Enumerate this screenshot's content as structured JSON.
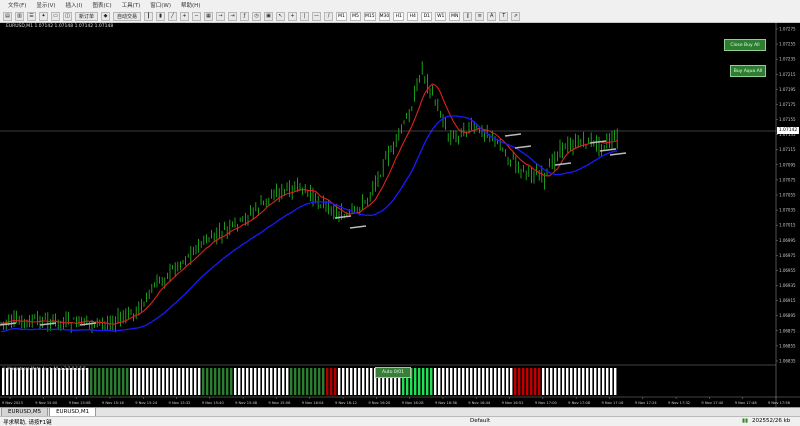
{
  "menu": [
    "文件(F)",
    "显示(V)",
    "插入(I)",
    "图表(C)",
    "工具(T)",
    "窗口(W)",
    "帮助(H)"
  ],
  "toolbar": {
    "new_order": "新订单",
    "autotrade": "自动交易",
    "timeframes": [
      "M1",
      "M5",
      "M15",
      "M30",
      "H1",
      "H4",
      "D1",
      "W1",
      "MN"
    ]
  },
  "chart": {
    "symbol_info": "EURUSD,M1  1.07142 1.07148 1.07142 1.07148",
    "current_price": "1.07142",
    "button_top": "Close Buy All",
    "button_mid": "Buy Aqua All",
    "indicator_label": "Ⓒ Marketcore Meta 4u  ↑ 40  ↓ 2  2.8  1.5.5",
    "indicator_button": "Auto 0/01",
    "y_ticks": [
      "1.07275",
      "1.07255",
      "1.07235",
      "1.07215",
      "1.07195",
      "1.07175",
      "1.07155",
      "1.07135",
      "1.07115",
      "1.07095",
      "1.07075",
      "1.07055",
      "1.07035",
      "1.07015",
      "1.06995",
      "1.06975",
      "1.06955",
      "1.06935",
      "1.06915",
      "1.06895",
      "1.06875",
      "1.06855",
      "1.06835"
    ],
    "x_ticks": [
      "9 Nov 2023",
      "9 Nov 15:00",
      "9 Nov 15:08",
      "9 Nov 15:16",
      "9 Nov 15:24",
      "9 Nov 15:32",
      "9 Nov 15:40",
      "9 Nov 15:48",
      "9 Nov 15:56",
      "9 Nov 16:04",
      "9 Nov 16:12",
      "9 Nov 16:20",
      "9 Nov 16:28",
      "9 Nov 16:36",
      "9 Nov 16:44",
      "9 Nov 16:52",
      "9 Nov 17:00",
      "9 Nov 17:08",
      "9 Nov 17:16",
      "9 Nov 17:24",
      "9 Nov 17:32",
      "9 Nov 17:40",
      "9 Nov 17:48",
      "9 Nov 17:56"
    ]
  },
  "tabs": [
    "EURUSD,M5",
    "EURUSD,M1"
  ],
  "status": {
    "help": "寻求帮助, 请按F1键",
    "profile": "Default",
    "traffic": "202552/26 kb"
  },
  "colors": {
    "candle": "#22c022",
    "ma_fast": "#e02020",
    "ma_slow": "#1a1aff",
    "bg": "#000000"
  }
}
